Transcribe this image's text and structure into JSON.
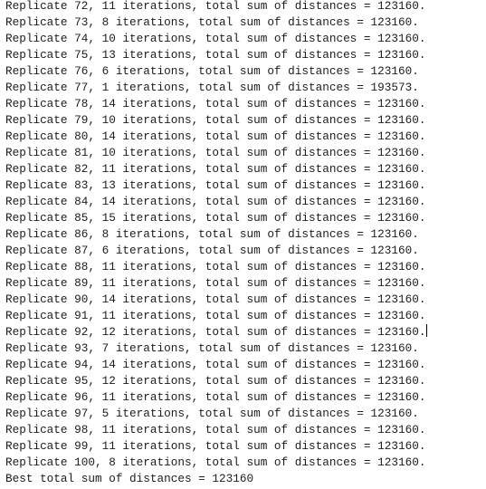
{
  "console": {
    "lines": [
      "Replicate 72, 11 iterations, total sum of distances = 123160.",
      "Replicate 73, 8 iterations, total sum of distances = 123160.",
      "Replicate 74, 10 iterations, total sum of distances = 123160.",
      "Replicate 75, 13 iterations, total sum of distances = 123160.",
      "Replicate 76, 6 iterations, total sum of distances = 123160.",
      "Replicate 77, 1 iterations, total sum of distances = 193573.",
      "Replicate 78, 14 iterations, total sum of distances = 123160.",
      "Replicate 79, 10 iterations, total sum of distances = 123160.",
      "Replicate 80, 14 iterations, total sum of distances = 123160.",
      "Replicate 81, 10 iterations, total sum of distances = 123160.",
      "Replicate 82, 11 iterations, total sum of distances = 123160.",
      "Replicate 83, 13 iterations, total sum of distances = 123160.",
      "Replicate 84, 14 iterations, total sum of distances = 123160.",
      "Replicate 85, 15 iterations, total sum of distances = 123160.",
      "Replicate 86, 8 iterations, total sum of distances = 123160.",
      "Replicate 87, 6 iterations, total sum of distances = 123160.",
      "Replicate 88, 11 iterations, total sum of distances = 123160.",
      "Replicate 89, 11 iterations, total sum of distances = 123160.",
      "Replicate 90, 14 iterations, total sum of distances = 123160.",
      "Replicate 91, 11 iterations, total sum of distances = 123160.",
      "Replicate 92, 12 iterations, total sum of distances = 123160.",
      "Replicate 93, 7 iterations, total sum of distances = 123160.",
      "Replicate 94, 14 iterations, total sum of distances = 123160.",
      "Replicate 95, 12 iterations, total sum of distances = 123160.",
      "Replicate 96, 11 iterations, total sum of distances = 123160.",
      "Replicate 97, 5 iterations, total sum of distances = 123160.",
      "Replicate 98, 11 iterations, total sum of distances = 123160.",
      "Replicate 99, 11 iterations, total sum of distances = 123160.",
      "Replicate 100, 8 iterations, total sum of distances = 123160.",
      "Best total sum of distances = 123160"
    ],
    "text_color": "#1c1c1c",
    "background_color": "#ffffff"
  }
}
